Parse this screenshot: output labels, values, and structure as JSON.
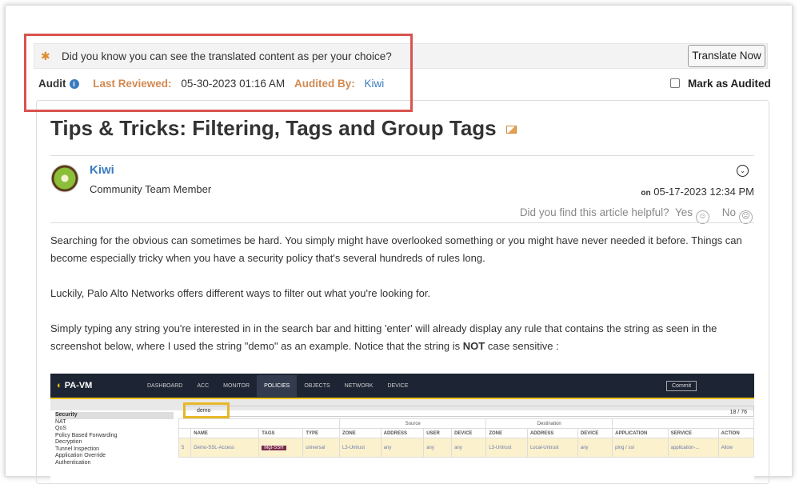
{
  "banner": {
    "text": "Did you know you can see the translated content as per your choice?",
    "button": "Translate Now"
  },
  "audit": {
    "label": "Audit",
    "last_reviewed_label": "Last Reviewed:",
    "last_reviewed": "05-30-2023 01:16 AM",
    "audited_by_label": "Audited By:",
    "audited_by": "Kiwi",
    "mark_label": "Mark as Audited"
  },
  "article": {
    "title": "Tips & Tricks: Filtering, Tags and Group Tags",
    "author": "Kiwi",
    "role": "Community Team Member",
    "date_prefix": "on",
    "date": "05-17-2023 12:34 PM",
    "helpful_q": "Did you find this article helpful?",
    "yes": "Yes",
    "no": "No",
    "paragraphs": [
      "Searching for the obvious can sometimes be hard. You simply might have overlooked something or you might have never needed it before. Things can become especially tricky when you have a security policy that's several hundreds of rules long.",
      "Luckily, Palo Alto Networks offers different ways to filter out what you're looking for."
    ],
    "p3_before": "Simply typing any string you're interested in in the search bar and hitting 'enter' will already display any rule that contains the string as seen in the screenshot below, where I used the string \"demo\" as an example. Notice that the string is ",
    "p3_bold": "NOT",
    "p3_after": " case sensitive :"
  },
  "screenshot": {
    "logo": "PA-VM",
    "tabs": [
      "DASHBOARD",
      "ACC",
      "MONITOR",
      "POLICIES",
      "OBJECTS",
      "NETWORK",
      "DEVICE"
    ],
    "commit": "Commit",
    "search": "demo",
    "count": "18 / 76",
    "side": [
      "Security",
      "NAT",
      "QoS",
      "Policy Based Forwarding",
      "Decryption",
      "Tunnel Inspection",
      "Application Override",
      "Authentication"
    ],
    "groups": {
      "source": "Source",
      "destination": "Destination"
    },
    "cols": [
      "",
      "NAME",
      "TAGS",
      "TYPE",
      "ZONE",
      "ADDRESS",
      "USER",
      "DEVICE",
      "ZONE",
      "ADDRESS",
      "DEVICE",
      "APPLICATION",
      "SERVICE",
      "ACTION"
    ],
    "row": [
      "5",
      "Demo-SSL-Access",
      "Mgt-SSH",
      "universal",
      "L3-Untrust",
      "any",
      "any",
      "any",
      "L3-Untrust",
      "Local-Untrust",
      "any",
      "ping / ssl",
      "application-...",
      "Allow"
    ]
  }
}
